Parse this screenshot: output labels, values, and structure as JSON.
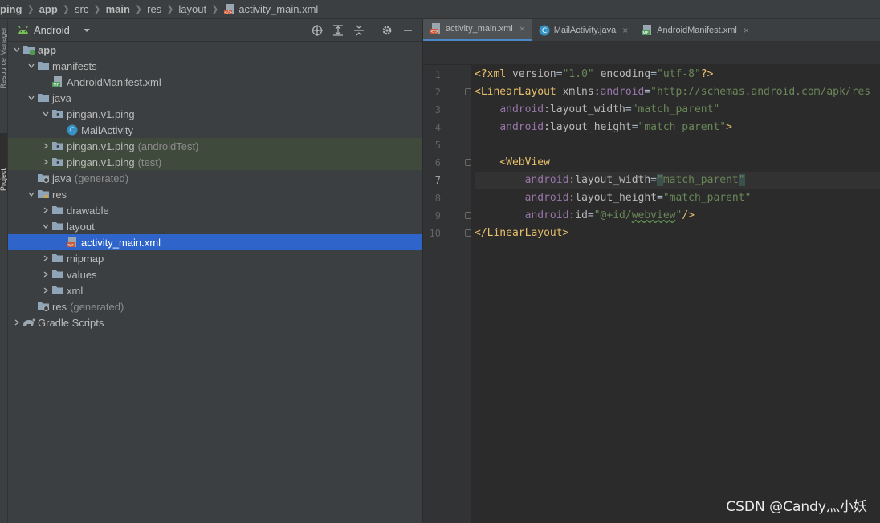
{
  "breadcrumb": [
    {
      "label": "ping",
      "bold": true
    },
    {
      "label": "app",
      "bold": true
    },
    {
      "label": "src",
      "bold": false
    },
    {
      "label": "main",
      "bold": true
    },
    {
      "label": "res",
      "bold": false
    },
    {
      "label": "layout",
      "bold": false
    },
    {
      "label": "activity_main.xml",
      "bold": false
    }
  ],
  "stripe": {
    "resource_manager": "Resource Manager",
    "project": "Project"
  },
  "panel": {
    "view_label": "Android"
  },
  "tree": [
    {
      "label": "app",
      "suffix": "",
      "depth": 0,
      "arrow": "down",
      "icon": "module-folder-icon",
      "bold": true
    },
    {
      "label": "manifests",
      "suffix": "",
      "depth": 1,
      "arrow": "down",
      "icon": "folder-icon"
    },
    {
      "label": "AndroidManifest.xml",
      "suffix": "",
      "depth": 2,
      "arrow": "",
      "icon": "manifest-file-icon"
    },
    {
      "label": "java",
      "suffix": "",
      "depth": 1,
      "arrow": "down",
      "icon": "folder-icon"
    },
    {
      "label": "pingan.v1.ping",
      "suffix": "",
      "depth": 2,
      "arrow": "down",
      "icon": "package-icon"
    },
    {
      "label": "MailActivity",
      "suffix": "",
      "depth": 3,
      "arrow": "",
      "icon": "class-icon"
    },
    {
      "label": "pingan.v1.ping",
      "suffix": "(androidTest)",
      "depth": 2,
      "arrow": "right",
      "icon": "package-icon",
      "tint": true
    },
    {
      "label": "pingan.v1.ping",
      "suffix": "(test)",
      "depth": 2,
      "arrow": "right",
      "icon": "package-icon",
      "tint": true
    },
    {
      "label": "java",
      "suffix": "(generated)",
      "depth": 1,
      "arrow": "",
      "icon": "generated-folder-icon"
    },
    {
      "label": "res",
      "suffix": "",
      "depth": 1,
      "arrow": "down",
      "icon": "res-folder-icon"
    },
    {
      "label": "drawable",
      "suffix": "",
      "depth": 2,
      "arrow": "right",
      "icon": "folder-icon"
    },
    {
      "label": "layout",
      "suffix": "",
      "depth": 2,
      "arrow": "down",
      "icon": "folder-icon"
    },
    {
      "label": "activity_main.xml",
      "suffix": "",
      "depth": 3,
      "arrow": "",
      "icon": "layout-file-icon",
      "selected": true
    },
    {
      "label": "mipmap",
      "suffix": "",
      "depth": 2,
      "arrow": "right",
      "icon": "folder-icon"
    },
    {
      "label": "values",
      "suffix": "",
      "depth": 2,
      "arrow": "right",
      "icon": "folder-icon"
    },
    {
      "label": "xml",
      "suffix": "",
      "depth": 2,
      "arrow": "right",
      "icon": "folder-icon"
    },
    {
      "label": "res",
      "suffix": "(generated)",
      "depth": 1,
      "arrow": "",
      "icon": "generated-folder-icon"
    },
    {
      "label": "Gradle Scripts",
      "suffix": "",
      "depth": 0,
      "arrow": "right",
      "icon": "gradle-icon"
    }
  ],
  "tabs": [
    {
      "label": "activity_main.xml",
      "icon": "layout-file-icon",
      "active": true
    },
    {
      "label": "MailActivity.java",
      "icon": "class-icon",
      "active": false
    },
    {
      "label": "AndroidManifest.xml",
      "icon": "manifest-file-icon",
      "active": false
    }
  ],
  "code_lines": [
    {
      "n": "1",
      "tokens": [
        [
          "t-tag",
          "<?xml "
        ],
        [
          "t-attr",
          "version"
        ],
        [
          "t-plain",
          "="
        ],
        [
          "t-val",
          "\"1.0\""
        ],
        [
          "t-plain",
          " "
        ],
        [
          "t-attr",
          "encoding"
        ],
        [
          "t-plain",
          "="
        ],
        [
          "t-val",
          "\"utf-8\""
        ],
        [
          "t-tag",
          "?>"
        ]
      ]
    },
    {
      "n": "2",
      "tokens": [
        [
          "t-tag",
          "<LinearLayout "
        ],
        [
          "t-attr",
          "xmlns:"
        ],
        [
          "t-ns",
          "android"
        ],
        [
          "t-plain",
          "="
        ],
        [
          "t-val",
          "\"http://schemas.android.com/apk/res"
        ]
      ]
    },
    {
      "n": "3",
      "tokens": [
        [
          "t-plain",
          "    "
        ],
        [
          "t-ns",
          "android"
        ],
        [
          "t-attr",
          ":layout_width"
        ],
        [
          "t-plain",
          "="
        ],
        [
          "t-val",
          "\"match_parent\""
        ]
      ]
    },
    {
      "n": "4",
      "tokens": [
        [
          "t-plain",
          "    "
        ],
        [
          "t-ns",
          "android"
        ],
        [
          "t-attr",
          ":layout_height"
        ],
        [
          "t-plain",
          "="
        ],
        [
          "t-val",
          "\"match_parent\""
        ],
        [
          "t-tag",
          ">"
        ]
      ]
    },
    {
      "n": "5",
      "tokens": []
    },
    {
      "n": "6",
      "tokens": [
        [
          "t-plain",
          "    "
        ],
        [
          "t-tag",
          "<WebView"
        ]
      ]
    },
    {
      "n": "7",
      "tokens": [
        [
          "t-plain",
          "        "
        ],
        [
          "t-ns",
          "android"
        ],
        [
          "t-attr",
          ":layout_width"
        ],
        [
          "t-plain",
          "="
        ],
        [
          "t-val t-hl",
          "\""
        ],
        [
          "t-val",
          "match_parent"
        ],
        [
          "t-val t-hl",
          "\""
        ]
      ]
    },
    {
      "n": "8",
      "tokens": [
        [
          "t-plain",
          "        "
        ],
        [
          "t-ns",
          "android"
        ],
        [
          "t-attr",
          ":layout_height"
        ],
        [
          "t-plain",
          "="
        ],
        [
          "t-val",
          "\"match_parent\""
        ]
      ]
    },
    {
      "n": "9",
      "tokens": [
        [
          "t-plain",
          "        "
        ],
        [
          "t-ns",
          "android"
        ],
        [
          "t-attr",
          ":id"
        ],
        [
          "t-plain",
          "="
        ],
        [
          "t-val",
          "\"@+id/"
        ],
        [
          "t-val wavy",
          "webview"
        ],
        [
          "t-val",
          "\""
        ],
        [
          "t-tag",
          "/>"
        ]
      ]
    },
    {
      "n": "10",
      "tokens": [
        [
          "t-tag",
          "</LinearLayout>"
        ]
      ]
    }
  ],
  "current_line": 7,
  "watermark": "CSDN @Candy灬小妖"
}
